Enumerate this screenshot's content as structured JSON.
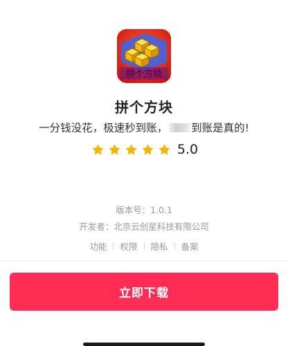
{
  "app": {
    "name": "拼个方块",
    "icon_name": "block-puzzle-app-icon",
    "icon_text": "拼个方块",
    "tagline_before": "一分钱没花，极速秒到账，",
    "tagline_after": "到账是真的!",
    "rating_stars": 5,
    "rating_score": "5.0"
  },
  "meta": {
    "version": "版本号：1.0.1",
    "developer": "开发者：北京云创星科技有限公司"
  },
  "links": {
    "features": "功能",
    "permissions": "权限",
    "privacy": "隐私",
    "filing": "备案"
  },
  "download": {
    "label": "立即下载"
  },
  "colors": {
    "accent": "#fe2c55",
    "star": "#f7b500",
    "muted_text": "#9a9a9a"
  }
}
